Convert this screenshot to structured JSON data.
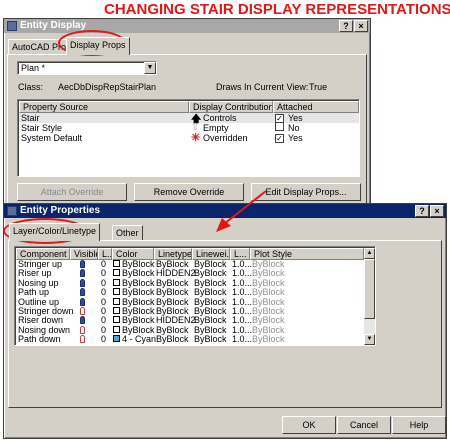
{
  "annotation": {
    "headline": "CHANGING STAIR DISPLAY REPRESENTATIONS",
    "color": "#e01818"
  },
  "entity_display": {
    "title": "Entity Display",
    "tabs": [
      "AutoCAD Props",
      "Display Props"
    ],
    "active_tab": "Display Props",
    "display_dropdown": "Plan *",
    "class_label": "Class:",
    "class_value": "AecDbDispRepStairPlan",
    "draws_label": "Draws In Current View:",
    "draws_value": "True",
    "columns": [
      "Property Source",
      "Display Contribution",
      "Attached"
    ],
    "rows": [
      {
        "source": "Stair",
        "contribution": "Controls",
        "attached": "Yes",
        "checked": true,
        "icon": "up-arrow-icon"
      },
      {
        "source": "Stair Style",
        "contribution": "Empty",
        "attached": "No",
        "checked": false,
        "icon": "empty-arrow-icon"
      },
      {
        "source": "System Default",
        "contribution": "Overridden",
        "attached": "Yes",
        "checked": true,
        "icon": "overridden-icon"
      }
    ],
    "buttons": {
      "attach": "Attach Override",
      "remove": "Remove Override",
      "edit": "Edit Display Props..."
    }
  },
  "entity_properties": {
    "title": "Entity Properties",
    "tabs": [
      "Layer/Color/Linetype",
      "Other"
    ],
    "active_tab": "Layer/Color/Linetype",
    "columns": [
      "Component",
      "Visible",
      "L..",
      "Color",
      "Linetype",
      "Linewei...",
      "L...",
      "Plot Style"
    ],
    "rows": [
      {
        "component": "Stringer up",
        "visible": true,
        "l": "0",
        "color": "ByBlock",
        "swatch": "#ffffff",
        "linetype": "ByBlock",
        "lineweight": "ByBlock",
        "lts": "1.0...",
        "plot": "ByBlock"
      },
      {
        "component": "Riser up",
        "visible": true,
        "l": "0",
        "color": "ByBlock",
        "swatch": "#ffffff",
        "linetype": "HIDDEN2",
        "lineweight": "ByBlock",
        "lts": "1.0...",
        "plot": "ByBlock"
      },
      {
        "component": "Nosing up",
        "visible": true,
        "l": "0",
        "color": "ByBlock",
        "swatch": "#ffffff",
        "linetype": "ByBlock",
        "lineweight": "ByBlock",
        "lts": "1.0...",
        "plot": "ByBlock"
      },
      {
        "component": "Path up",
        "visible": true,
        "l": "0",
        "color": "ByBlock",
        "swatch": "#ffffff",
        "linetype": "ByBlock",
        "lineweight": "ByBlock",
        "lts": "1.0...",
        "plot": "ByBlock"
      },
      {
        "component": "Outline up",
        "visible": true,
        "l": "0",
        "color": "ByBlock",
        "swatch": "#ffffff",
        "linetype": "ByBlock",
        "lineweight": "ByBlock",
        "lts": "1.0...",
        "plot": "ByBlock"
      },
      {
        "component": "Stringer down",
        "visible": false,
        "l": "0",
        "color": "ByBlock",
        "swatch": "#ffffff",
        "linetype": "ByBlock",
        "lineweight": "ByBlock",
        "lts": "1.0...",
        "plot": "ByBlock"
      },
      {
        "component": "Riser down",
        "visible": true,
        "l": "0",
        "color": "ByBlock",
        "swatch": "#ffffff",
        "linetype": "HIDDEN2",
        "lineweight": "ByBlock",
        "lts": "1.0...",
        "plot": "ByBlock"
      },
      {
        "component": "Nosing down",
        "visible": false,
        "l": "0",
        "color": "ByBlock",
        "swatch": "#ffffff",
        "linetype": "ByBlock",
        "lineweight": "ByBlock",
        "lts": "1.0...",
        "plot": "ByBlock"
      },
      {
        "component": "Path down",
        "visible": false,
        "l": "0",
        "color": "4 - Cyan",
        "swatch": "#4aa6d8",
        "linetype": "ByBlock",
        "lineweight": "ByBlock",
        "lts": "1.0...",
        "plot": "ByBlock"
      }
    ],
    "buttons": {
      "ok": "OK",
      "cancel": "Cancel",
      "help": "Help"
    }
  }
}
